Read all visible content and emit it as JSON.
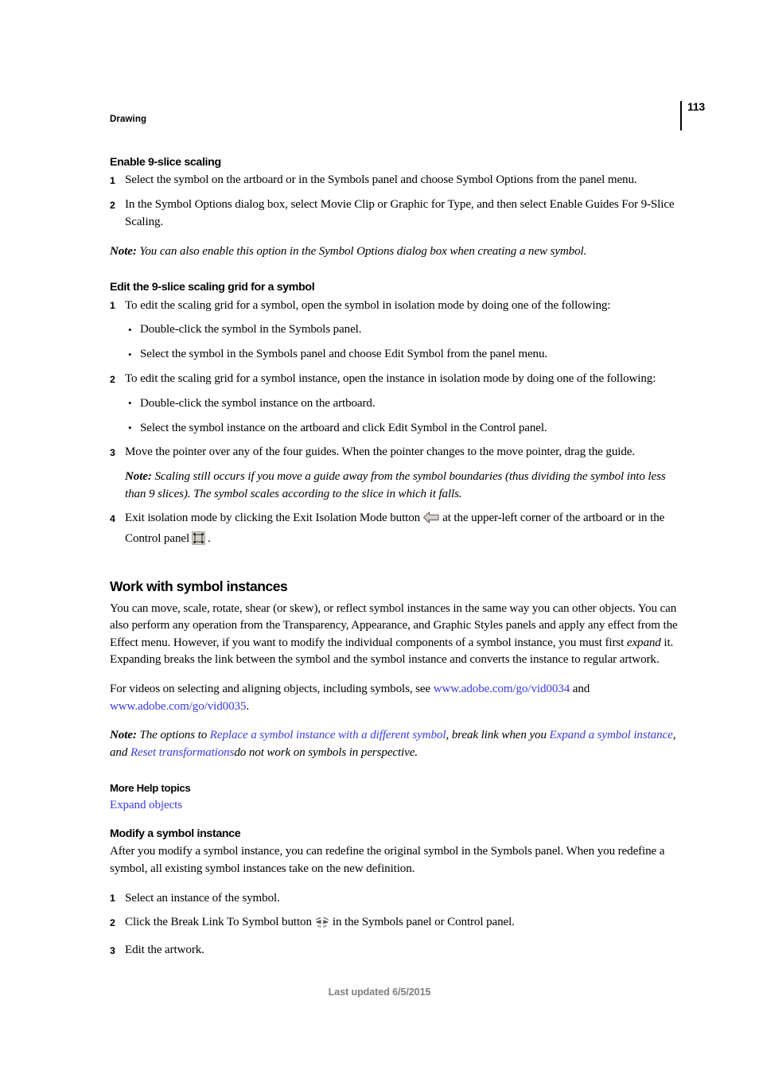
{
  "header": {
    "running_head": "Drawing",
    "page_number": "113"
  },
  "footer": {
    "last_updated": "Last updated 6/5/2015"
  },
  "sections": {
    "enable_9slice": {
      "heading": "Enable 9-slice scaling",
      "step1_num": "1",
      "step1_text": "Select the symbol on the artboard or in the Symbols panel and choose Symbol Options from the panel menu.",
      "step2_num": "2",
      "step2_text": "In the Symbol Options dialog box, select Movie Clip or Graphic for Type, and then select Enable Guides For 9-Slice Scaling.",
      "note_label": "Note:",
      "note_text": "You can also enable this option in the Symbol Options dialog box when creating a new symbol."
    },
    "edit_grid": {
      "heading": "Edit the 9-slice scaling grid for a symbol",
      "step1_num": "1",
      "step1_text": "To edit the scaling grid for a symbol, open the symbol in isolation mode by doing one of the following:",
      "bullet1": "Double-click the symbol in the Symbols panel.",
      "bullet2": "Select the symbol in the Symbols panel and choose Edit Symbol from the panel menu.",
      "step2_num": "2",
      "step2_text": "To edit the scaling grid for a symbol instance, open the instance in isolation mode by doing one of the following:",
      "bullet3": "Double-click the symbol instance on the artboard.",
      "bullet4": "Select the symbol instance on the artboard and click Edit Symbol in the Control panel.",
      "step3_num": "3",
      "step3_text": "Move the pointer over any of the four guides. When the pointer changes to the move pointer, drag the guide.",
      "note_label": "Note:",
      "note_text": "Scaling still occurs if you move a guide away from the symbol boundaries (thus dividing the symbol into less than 9 slices). The symbol scales according to the slice in which it falls.",
      "step4_num": "4",
      "step4_text_a": "Exit isolation mode by clicking the Exit Isolation Mode button",
      "step4_icon_a": "exit-isolation-mode-icon",
      "step4_text_b": "at the upper-left corner of the artboard or in the Control panel",
      "step4_icon_b": "isolation-mode-control-icon",
      "step4_text_c": "."
    },
    "work_with": {
      "heading": "Work with symbol instances",
      "para1_a": "You can move, scale, rotate, shear (or skew), or reflect symbol instances in the same way you can other objects. You can also perform any operation from the Transparency, Appearance, and Graphic Styles panels and apply any effect from the Effect menu. However, if you want to modify the individual components of a symbol instance, you must first ",
      "para1_em": "expand",
      "para1_b": " it. Expanding breaks the link between the symbol and the symbol instance and converts the instance to regular artwork.",
      "para2_a": "For videos on selecting and aligning objects, including symbols, see ",
      "para2_link1": "www.adobe.com/go/vid0034",
      "para2_b": " and ",
      "para2_link2": "www.adobe.com/go/vid0035",
      "para2_c": ".",
      "note_label": "Note:",
      "note_a": "The options to ",
      "note_link1": "Replace a symbol instance with a different symbol",
      "note_b": ", break link when you ",
      "note_link2": "Expand a symbol instance",
      "note_c": ", and ",
      "note_link3": "Reset transformations",
      "note_d": "do not work on symbols in perspective."
    },
    "more_help": {
      "heading": "More Help topics",
      "link1": "Expand objects"
    },
    "modify": {
      "heading": "Modify a symbol instance",
      "para1": "After you modify a symbol instance, you can redefine the original symbol in the Symbols panel. When you redefine a symbol, all existing symbol instances take on the new definition.",
      "step1_num": "1",
      "step1_text": "Select an instance of the symbol.",
      "step2_num": "2",
      "step2_text_a": "Click the Break Link To Symbol button",
      "step2_icon": "break-link-to-symbol-icon",
      "step2_text_b": "in the Symbols panel or Control panel.",
      "step3_num": "3",
      "step3_text": "Edit the artwork."
    }
  },
  "colors": {
    "link": "#3a3ae0",
    "footer_text": "#808080",
    "body_text": "#000000"
  }
}
